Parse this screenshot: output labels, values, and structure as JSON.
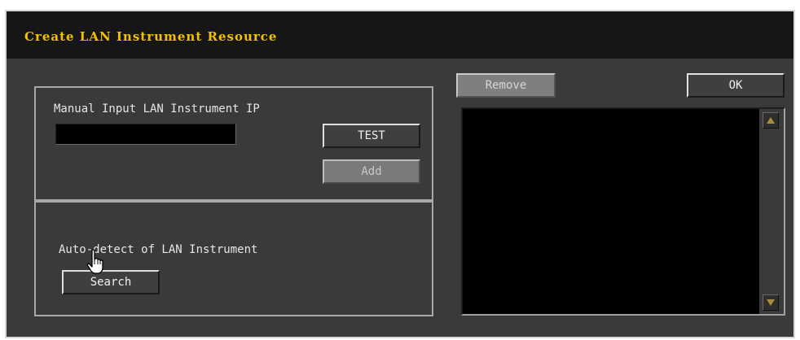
{
  "dialog": {
    "title": "Create LAN Instrument Resource"
  },
  "manual_panel": {
    "label": "Manual Input LAN Instrument IP",
    "ip_value": "",
    "test_label": "TEST",
    "add_label": "Add"
  },
  "auto_panel": {
    "label": "Auto-detect of LAN Instrument",
    "search_label": "Search"
  },
  "right_panel": {
    "remove_label": "Remove",
    "ok_label": "OK",
    "instrument_list": []
  },
  "colors": {
    "title_text": "#f2c200",
    "background": "#3a3a3a",
    "list_background": "#000000"
  },
  "icons": {
    "pointer": "hand-pointer-icon",
    "scroll_up": "scroll-up-arrow-icon",
    "scroll_down": "scroll-down-arrow-icon"
  }
}
